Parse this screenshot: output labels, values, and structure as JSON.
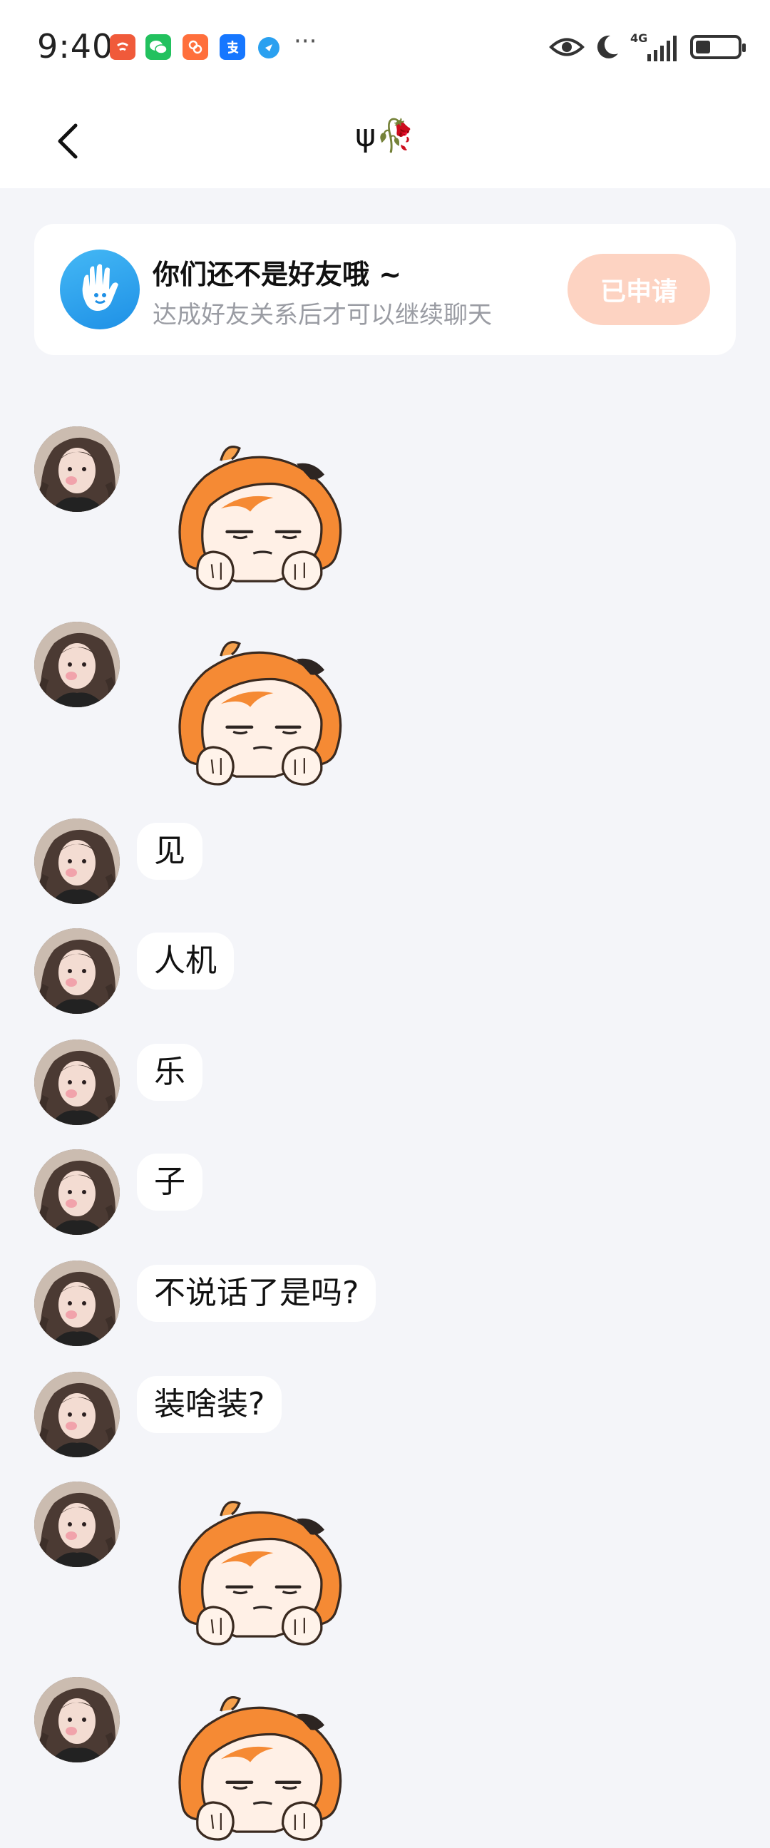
{
  "status_bar": {
    "time": "9:40",
    "apps": [
      {
        "icon": "taobao-app-icon",
        "color": "#f05a3a",
        "glyph": "淘"
      },
      {
        "icon": "wechat-app-icon",
        "color": "#22c15e",
        "glyph": "微"
      },
      {
        "icon": "redbook-app-icon",
        "color": "#ff6f3c",
        "glyph": "书"
      },
      {
        "icon": "alipay-app-icon",
        "color": "#1677ff",
        "glyph": "支"
      },
      {
        "icon": "tool-app-icon",
        "color": "#2aa0f0",
        "glyph": ""
      }
    ],
    "more": "···",
    "network": "4G",
    "battery_level_percent": 35
  },
  "header": {
    "back_icon": "chevron-left-icon",
    "title": "ψ🥀"
  },
  "friend_notice": {
    "title": "你们还不是好友哦 ~",
    "subtitle": "达成好友关系后才可以继续聊天",
    "button_label": "已申请",
    "icon": "wave-hand-icon",
    "accent_color": "#fdd3c2"
  },
  "messages": [
    {
      "type": "sticker",
      "sticker": "orange-bear-sticker"
    },
    {
      "type": "sticker",
      "sticker": "orange-bear-sticker"
    },
    {
      "type": "text",
      "text": "见"
    },
    {
      "type": "text",
      "text": "人机"
    },
    {
      "type": "text",
      "text": "乐"
    },
    {
      "type": "text",
      "text": "子"
    },
    {
      "type": "text",
      "text": "不说话了是吗?"
    },
    {
      "type": "text",
      "text": "装啥装?"
    },
    {
      "type": "sticker",
      "sticker": "orange-bear-sticker"
    },
    {
      "type": "sticker",
      "sticker": "orange-bear-sticker"
    }
  ]
}
